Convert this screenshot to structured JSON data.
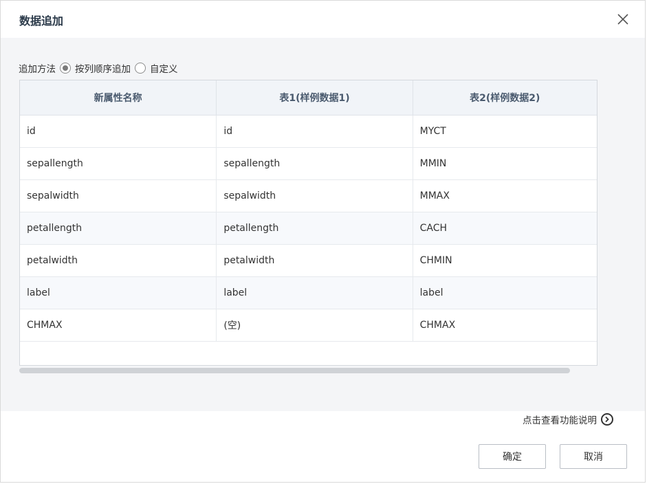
{
  "dialog": {
    "title": "数据追加",
    "close_icon": "close-icon"
  },
  "method": {
    "label": "追加方法",
    "options": [
      {
        "label": "按列顺序追加",
        "selected": true
      },
      {
        "label": "自定义",
        "selected": false
      }
    ]
  },
  "table": {
    "headers": [
      "新属性名称",
      "表1(样例数据1)",
      "表2(样例数据2)"
    ],
    "rows": [
      [
        "id",
        "id",
        "MYCT"
      ],
      [
        "sepallength",
        "sepallength",
        "MMIN"
      ],
      [
        "sepalwidth",
        "sepalwidth",
        "MMAX"
      ],
      [
        "petallength",
        "petallength",
        "CACH"
      ],
      [
        "petalwidth",
        "petalwidth",
        "CHMIN"
      ],
      [
        "label",
        "label",
        "label"
      ],
      [
        "CHMAX",
        "(空)",
        "CHMAX"
      ]
    ]
  },
  "help": {
    "text": "点击查看功能说明",
    "icon": "chevron-right-circle-icon"
  },
  "buttons": {
    "ok": "确定",
    "cancel": "取消"
  }
}
